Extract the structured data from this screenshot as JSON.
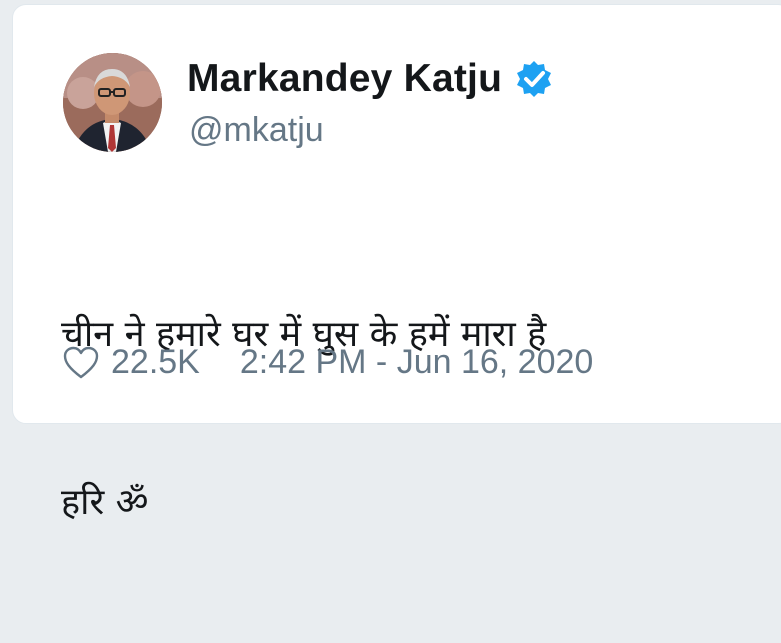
{
  "tweet": {
    "author_name": "Markandey Katju",
    "handle": "@mkatju",
    "verified_icon": "verified-badge-icon",
    "text_line1": "चीन ने हमारे घर में घुस के हमें मारा है",
    "text_line2": "हरि ॐ",
    "likes": "22.5K",
    "timestamp": "2:42 PM - Jun 16, 2020"
  },
  "colors": {
    "accent": "#1da1f2",
    "text": "#14171a",
    "muted": "#657786"
  }
}
